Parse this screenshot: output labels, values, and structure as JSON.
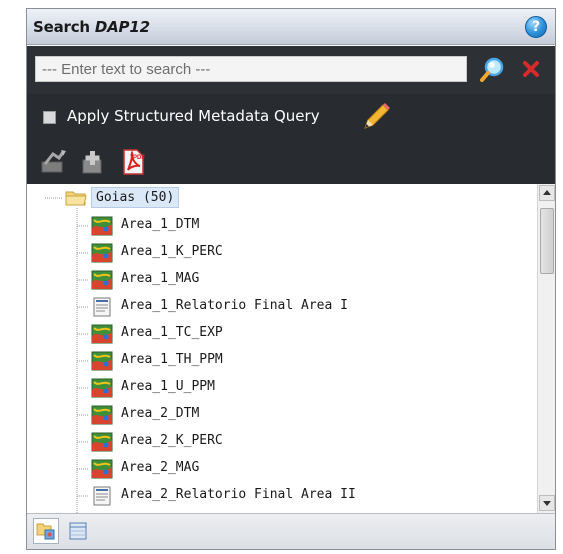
{
  "window": {
    "title_prefix": "Search ",
    "title_name": "DAP12",
    "help_label": "?"
  },
  "search": {
    "placeholder": "--- Enter text to search ---",
    "value": ""
  },
  "metadata_query": {
    "label": "Apply Structured Metadata Query",
    "checked": false
  },
  "tree": {
    "folder": {
      "label": "Goias (50)"
    },
    "items": [
      {
        "label": "Area_1_DTM",
        "icon": "raster-map-icon"
      },
      {
        "label": "Area_1_K_PERC",
        "icon": "raster-map-icon"
      },
      {
        "label": "Area_1_MAG",
        "icon": "raster-map-icon"
      },
      {
        "label": "Area_1_Relatorio Final Area I",
        "icon": "document-icon"
      },
      {
        "label": "Area_1_TC_EXP",
        "icon": "raster-map-icon"
      },
      {
        "label": "Area_1_TH_PPM",
        "icon": "raster-map-icon"
      },
      {
        "label": "Area_1_U_PPM",
        "icon": "raster-map-icon"
      },
      {
        "label": "Area_2_DTM",
        "icon": "raster-map-icon"
      },
      {
        "label": "Area_2_K_PERC",
        "icon": "raster-map-icon"
      },
      {
        "label": "Area_2_MAG",
        "icon": "raster-map-icon"
      },
      {
        "label": "Area_2_Relatorio Final Area II",
        "icon": "document-icon"
      }
    ]
  },
  "colors": {
    "dark_toolbar": "#282b2f",
    "selection": "#dbe8f7",
    "accent_red": "#d62b2b"
  }
}
